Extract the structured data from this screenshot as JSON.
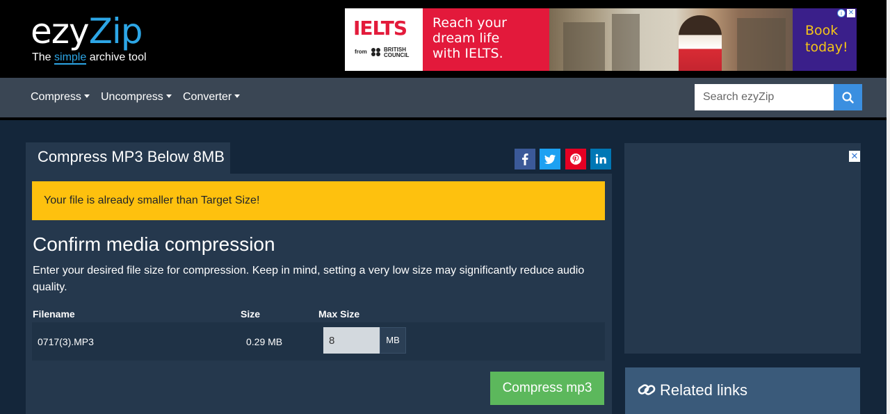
{
  "header": {
    "logo_main_prefix": "ezy",
    "logo_main_accent": "Zip",
    "tagline_pre": "The ",
    "tagline_simple": "simple",
    "tagline_post": " archive tool"
  },
  "ad": {
    "ielts_logo": "IELTS",
    "ielts_from": "from",
    "british_council": "BRITISH COUNCIL",
    "headline_line1": "Reach your",
    "headline_line2": "dream life",
    "headline_line3": "with IELTS.",
    "cta_line1": "Book",
    "cta_line2": "today!",
    "close": "✕",
    "info": "i"
  },
  "nav": {
    "items": [
      {
        "label": "Compress"
      },
      {
        "label": "Uncompress"
      },
      {
        "label": "Converter"
      }
    ],
    "search_placeholder": "Search ezyZip"
  },
  "main": {
    "tab_title": "Compress MP3 Below 8MB",
    "social": [
      "facebook-icon",
      "twitter-icon",
      "pinterest-icon",
      "linkedin-icon"
    ],
    "alert_text": "Your file is already smaller than Target Size!",
    "confirm_title": "Confirm media compression",
    "confirm_desc": "Enter your desired file size for compression. Keep in mind, setting a very low size may significantly reduce audio quality.",
    "table": {
      "headers": [
        "Filename",
        "Size",
        "Max Size"
      ],
      "row": {
        "filename": "0717(3).MP3",
        "size": "0.29 MB",
        "max_size": "8",
        "unit": "MB"
      }
    },
    "compress_button": "Compress mp3"
  },
  "sidebar": {
    "ad_close": "✕",
    "related_title": "Related links"
  },
  "colors": {
    "accent_blue": "#2da6e6",
    "alert_yellow": "#fec10e",
    "success_green": "#5cb85c",
    "page_bg": "#14263a",
    "panel_bg": "#25384d"
  }
}
